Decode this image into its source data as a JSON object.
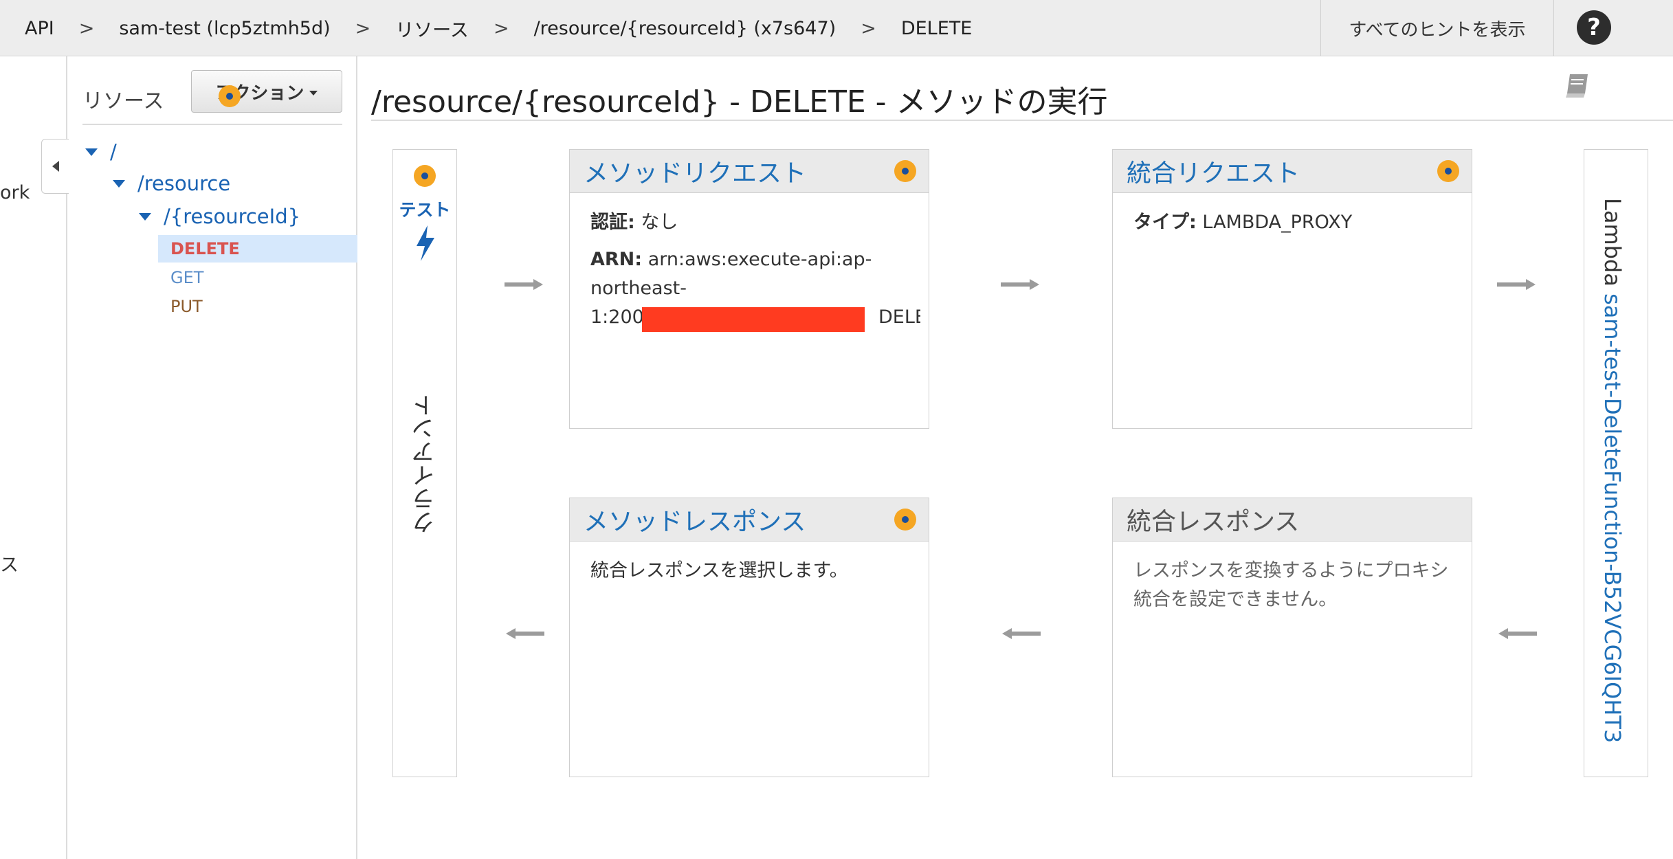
{
  "breadcrumbs": [
    "API",
    "sam-test (lcp5ztmh5d)",
    "リソース",
    "/resource/{resourceId} (x7s647)",
    "DELETE"
  ],
  "breadcrumb_separator": ">",
  "header": {
    "hints_label": "すべてのヒントを表示",
    "help_label": "?"
  },
  "left_nav": {
    "partial_items": [
      "ork",
      "ス"
    ]
  },
  "resources_panel": {
    "title": "リソース",
    "actions_label": "アクション",
    "tree": {
      "root": "/",
      "resource": "/resource",
      "resource_id": "/{resourceId}",
      "methods": [
        {
          "label": "DELETE",
          "color": "#d9534f",
          "selected": true
        },
        {
          "label": "GET",
          "color": "#5b8ec9",
          "selected": false
        },
        {
          "label": "PUT",
          "color": "#8b5a2b",
          "selected": false
        }
      ]
    }
  },
  "main": {
    "title": "/resource/{resourceId} - DELETE - メソッドの実行",
    "client": {
      "test_label": "テスト",
      "label": "クライアント"
    },
    "method_request": {
      "title": "メソッドリクエスト",
      "auth_label": "認証:",
      "auth_value": "なし",
      "arn_label": "ARN:",
      "arn_line1": "arn:aws:execute-api:ap-",
      "arn_line2": "northeast-",
      "arn_line3_start": "1:2004",
      "arn_line3_end": "DELETE"
    },
    "integration_request": {
      "title": "統合リクエスト",
      "type_label": "タイプ:",
      "type_value": "LAMBDA_PROXY"
    },
    "method_response": {
      "title": "メソッドレスポンス",
      "body": "統合レスポンスを選択します。"
    },
    "integration_response": {
      "title": "統合レスポンス",
      "body_line1": "レスポンスを変換するようにプロキシ",
      "body_line2": "統合を設定できません。"
    },
    "lambda": {
      "prefix": "Lambda",
      "function_name": "sam-test-DeleteFunction-B52VCG6IQHT3"
    }
  },
  "colors": {
    "accent": "#1f70b8",
    "info_dot": "#f5a623",
    "selection": "#d6e8fc",
    "redaction": "#ff3b20"
  }
}
